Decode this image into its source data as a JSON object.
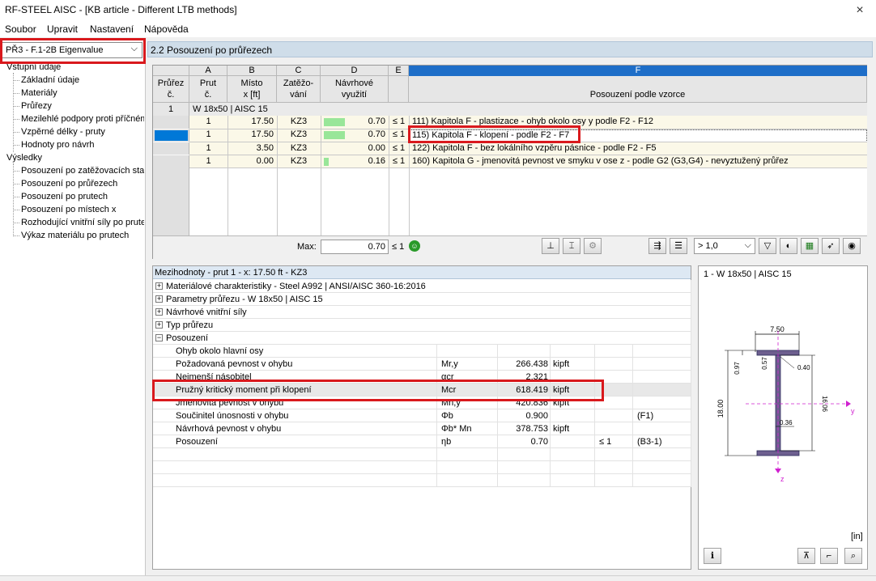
{
  "window": {
    "title": "RF-STEEL AISC - [KB article - Different LTB methods]",
    "close": "×"
  },
  "menu": [
    "Soubor",
    "Upravit",
    "Nastavení",
    "Nápověda"
  ],
  "nav": {
    "case_select": "PŘ3 - F.1-2B Eigenvalue",
    "input_group": "Vstupní údaje",
    "input_items": [
      "Základní údaje",
      "Materiály",
      "Průřezy",
      "Mezilehlé podpory proti příčném",
      "Vzpěrné délky - pruty",
      "Hodnoty pro návrh"
    ],
    "results_group": "Výsledky",
    "results_items": [
      "Posouzení po zatěžovacích stav",
      "Posouzení po průřezech",
      "Posouzení po prutech",
      "Posouzení po místech x",
      "Rozhodující vnitřní síly po prute",
      "Výkaz materiálu po prutech"
    ]
  },
  "panel_title": "2.2 Posouzení po průřezech",
  "table": {
    "col_letters": [
      "A",
      "B",
      "C",
      "D",
      "E",
      "F"
    ],
    "headers": {
      "prurez": [
        "Průřez",
        "č."
      ],
      "prut": [
        "Prut",
        "č."
      ],
      "misto": [
        "Místo",
        "x [ft]"
      ],
      "zatez": [
        "Zatěžo-",
        "vání"
      ],
      "navrh": [
        "Návrhové",
        "využití"
      ],
      "f": "Posouzení podle vzorce"
    },
    "group": {
      "num": "1",
      "label": "W 18x50 | AISC 15"
    },
    "rows": [
      {
        "prut": "1",
        "x": "17.50",
        "lc": "KZ3",
        "ratio": 0.7,
        "ratio_text": "0.70",
        "le": "≤ 1",
        "desc": "111) Kapitola F - plastizace - ohyb okolo osy y podle F2 - F12"
      },
      {
        "prut": "1",
        "x": "17.50",
        "lc": "KZ3",
        "ratio": 0.7,
        "ratio_text": "0.70",
        "le": "≤ 1",
        "desc": "115) Kapitola F - klopení - podle F2 - F7"
      },
      {
        "prut": "1",
        "x": "3.50",
        "lc": "KZ3",
        "ratio": 0.0,
        "ratio_text": "0.00",
        "le": "≤ 1",
        "desc": "122) Kapitola F - bez lokálního vzpěru pásnice - podle F2 - F5"
      },
      {
        "prut": "1",
        "x": "0.00",
        "lc": "KZ3",
        "ratio": 0.16,
        "ratio_text": "0.16",
        "le": "≤ 1",
        "desc": "160) Kapitola G - jmenovitá pevnost ve smyku v ose z - podle G2 (G3,G4) - nevyztužený průřez"
      }
    ],
    "max_label": "Max:",
    "max_value": "0.70",
    "max_le": "≤ 1",
    "filter_value": "> 1,0"
  },
  "details": {
    "title": "Mezihodnoty - prut 1 - x: 17.50 ft - KZ3",
    "groups": [
      "Materiálové charakteristiky - Steel A992 | ANSI/AISC 360-16:2016",
      "Parametry průřezu  -  W 18x50 | AISC 15",
      "Návrhové vnitřní síly",
      "Typ průřezu",
      "Posouzení"
    ],
    "subgroup": "Ohyb okolo hlavní osy",
    "rows": [
      {
        "label": "Požadovaná pevnost v ohybu",
        "sym": "Mr,y",
        "val": "266.438",
        "unit": "kipft",
        "le": "",
        "ref": ""
      },
      {
        "label": "Nejmenší násobitel",
        "sym": "αcr",
        "val": "2.321",
        "unit": "",
        "le": "",
        "ref": ""
      },
      {
        "label": "Pružný kritický moment při klopení",
        "sym": "Mcr",
        "val": "618.419",
        "unit": "kipft",
        "le": "",
        "ref": ""
      },
      {
        "label": "Jmenovitá pevnost v ohybu",
        "sym": "Mn,y",
        "val": "420.836",
        "unit": "kipft",
        "le": "",
        "ref": ""
      },
      {
        "label": "Součinitel únosnosti v ohybu",
        "sym": "Φb",
        "val": "0.900",
        "unit": "",
        "le": "",
        "ref": "(F1)"
      },
      {
        "label": "Návrhová pevnost v ohybu",
        "sym": "Φb* Mn",
        "val": "378.753",
        "unit": "kipft",
        "le": "",
        "ref": ""
      },
      {
        "label": "Posouzení",
        "sym": "ηb",
        "val": "0.70",
        "unit": "",
        "le": "≤ 1",
        "ref": "(B3-1)"
      }
    ]
  },
  "section": {
    "title": "1 - W 18x50 | AISC 15",
    "dims": {
      "flange_width": "7.50",
      "flange_t": "0.97",
      "k_dim": "0.57",
      "radius": "0.40",
      "depth": "18.00",
      "web_h": "16.06",
      "web_t": "0.36"
    },
    "axis_y": "y",
    "axis_z": "z",
    "units": "[in]"
  },
  "colors": {
    "highlight": "#d9191d",
    "ratio_bar": "#99e699",
    "selected_row": "#0078d7",
    "header_blue": "#1e6ec8"
  }
}
